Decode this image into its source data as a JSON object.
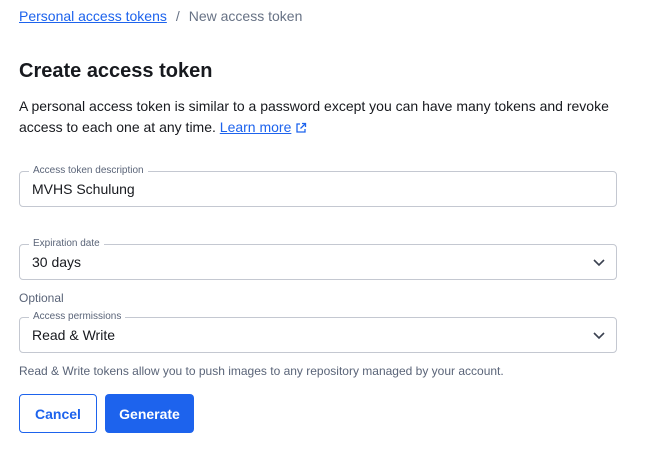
{
  "breadcrumb": {
    "parent": "Personal access tokens",
    "separator": "/",
    "current": "New access token"
  },
  "header": {
    "title": "Create access token",
    "description": "A personal access token is similar to a password except you can have many tokens and revoke access to each one at any time.",
    "learn_more": "Learn more"
  },
  "form": {
    "description_field": {
      "label": "Access token description",
      "value": "MVHS Schulung"
    },
    "expiration_field": {
      "label": "Expiration date",
      "value": "30 days"
    },
    "optional_text": "Optional",
    "permissions_field": {
      "label": "Access permissions",
      "value": "Read & Write"
    },
    "permissions_helper": "Read & Write tokens allow you to push images to any repository managed by your account."
  },
  "actions": {
    "cancel_label": "Cancel",
    "generate_label": "Generate"
  },
  "colors": {
    "accent": "#1d63ed",
    "text": "#17191e",
    "muted": "#677285",
    "border": "#c4c8d1"
  },
  "icons": {
    "external": "external-link-icon",
    "dropdown": "chevron-down-icon"
  }
}
